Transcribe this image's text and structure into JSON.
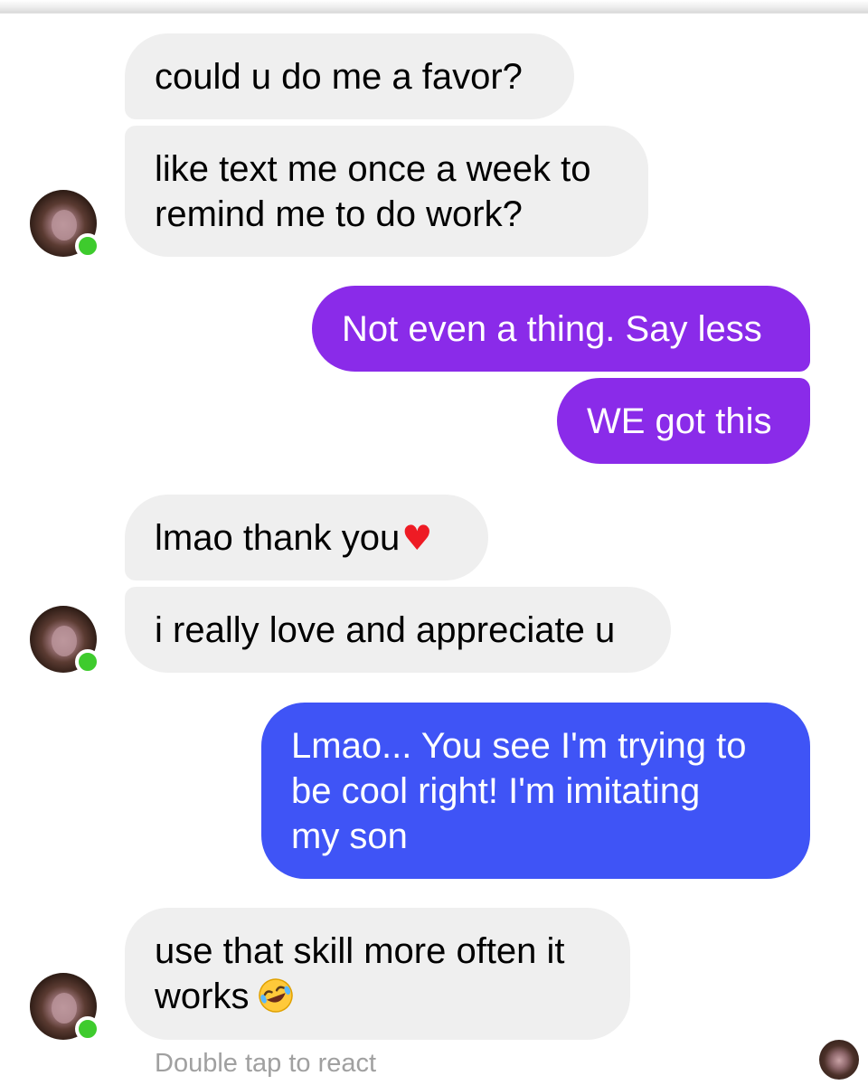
{
  "messages": [
    {
      "text": "could u do me a favor?"
    },
    {
      "text": "like text me once a week to\nremind me to do work?"
    },
    {
      "text": "Not even a thing. Say less"
    },
    {
      "text": "WE got this"
    },
    {
      "text": "lmao thank you",
      "emoji": "heart-icon"
    },
    {
      "text": "i really love and appreciate u"
    },
    {
      "text": "Lmao... You see I'm trying to\nbe cool right! I'm imitating\nmy son"
    },
    {
      "text": "use that skill more often it\nworks",
      "emoji": "laugh-icon"
    }
  ],
  "footer": {
    "react_hint": "Double tap to react"
  },
  "colors": {
    "incoming_bubble": "#efefef",
    "outgoing_purple": "#8a2be9",
    "outgoing_blue": "#3f54f6",
    "online_dot": "#3ecb2d",
    "hint_text": "#a0a0a0"
  }
}
